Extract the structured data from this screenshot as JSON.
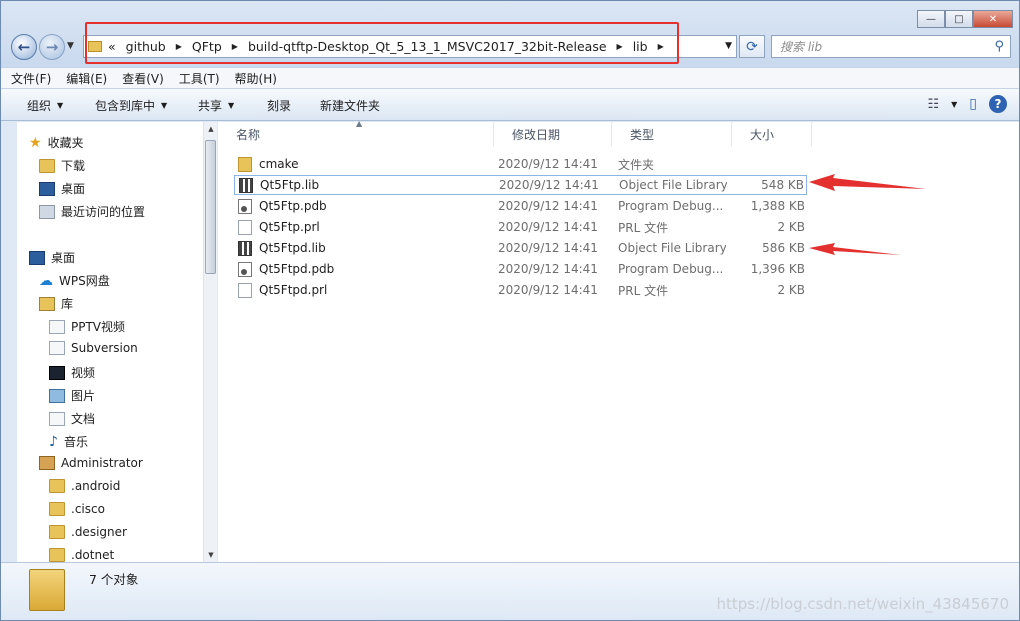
{
  "address": {
    "overflow": "«",
    "segments": [
      "github",
      "QFtp",
      "build-qtftp-Desktop_Qt_5_13_1_MSVC2017_32bit-Release",
      "lib"
    ]
  },
  "search": {
    "placeholder": "搜索 lib"
  },
  "menu": [
    "文件(F)",
    "编辑(E)",
    "查看(V)",
    "工具(T)",
    "帮助(H)"
  ],
  "toolbar": {
    "organize": "组织",
    "include": "包含到库中",
    "share": "共享",
    "burn": "刻录",
    "new_folder": "新建文件夹"
  },
  "nav": {
    "favorites": "收藏夹",
    "downloads": "下载",
    "desktop_fav": "桌面",
    "recent": "最近访问的位置",
    "desktop": "桌面",
    "wps": "WPS网盘",
    "libraries": "库",
    "pptv": "PPTV视频",
    "subversion": "Subversion",
    "videos": "视频",
    "pictures": "图片",
    "documents": "文档",
    "music": "音乐",
    "admin": "Administrator",
    "android": ".android",
    "cisco": ".cisco",
    "designer": ".designer",
    "dotnet": ".dotnet"
  },
  "columns": {
    "name": "名称",
    "date": "修改日期",
    "type": "类型",
    "size": "大小"
  },
  "files": [
    {
      "name": "cmake",
      "date": "2020/9/12 14:41",
      "type": "文件夹",
      "size": ""
    },
    {
      "name": "Qt5Ftp.lib",
      "date": "2020/9/12 14:41",
      "type": "Object File Library",
      "size": "548 KB"
    },
    {
      "name": "Qt5Ftp.pdb",
      "date": "2020/9/12 14:41",
      "type": "Program Debug...",
      "size": "1,388 KB"
    },
    {
      "name": "Qt5Ftp.prl",
      "date": "2020/9/12 14:41",
      "type": "PRL 文件",
      "size": "2 KB"
    },
    {
      "name": "Qt5Ftpd.lib",
      "date": "2020/9/12 14:41",
      "type": "Object File Library",
      "size": "586 KB"
    },
    {
      "name": "Qt5Ftpd.pdb",
      "date": "2020/9/12 14:41",
      "type": "Program Debug...",
      "size": "1,396 KB"
    },
    {
      "name": "Qt5Ftpd.prl",
      "date": "2020/9/12 14:41",
      "type": "PRL 文件",
      "size": "2 KB"
    }
  ],
  "status": {
    "count": "7 个对象"
  },
  "watermark": "https://blog.csdn.net/weixin_43845670",
  "colors": {
    "annotation": "#e53030",
    "selection_border": "#8bb5e3"
  }
}
